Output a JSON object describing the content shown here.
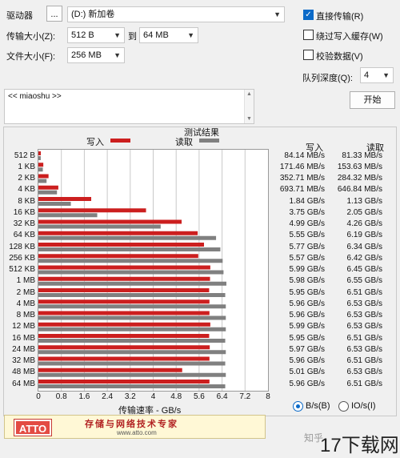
{
  "controls": {
    "drive_label": "驱动器",
    "drive_browse_label": "...",
    "drive_value": "(D:) 新加卷",
    "transfer_size_label": "传输大小(Z):",
    "transfer_from": "512 B",
    "to_label": "到",
    "transfer_to": "64 MB",
    "file_size_label": "文件大小(F):",
    "file_size": "256 MB",
    "direct_io_label": "直接传输(R)",
    "direct_io_checked": true,
    "bypass_cache_label": "绕过写入缓存(W)",
    "bypass_cache_checked": false,
    "verify_label": "校验数据(V)",
    "verify_checked": false,
    "queue_depth_label": "队列深度(Q):",
    "queue_depth": "4",
    "start_label": "开始",
    "description_text": "<< miaoshu >>"
  },
  "results": {
    "title": "测试结果",
    "write_legend": "写入",
    "read_legend": "读取",
    "write_header": "写入",
    "read_header": "读取",
    "x_axis_title": "传输速率 - GB/s",
    "unit_bs_label": "B/s(B)",
    "unit_bs_selected": true,
    "unit_io_label": "IO/s(I)",
    "unit_io_selected": false
  },
  "colors": {
    "write": "#cc1f1f",
    "read": "#808080"
  },
  "chart_data": {
    "type": "bar",
    "orientation": "horizontal",
    "title": "测试结果",
    "xlabel": "传输速率 - GB/s",
    "xlim": [
      0,
      8
    ],
    "x_ticks": [
      "0",
      "0.8",
      "1.6",
      "2.4",
      "3.2",
      "4",
      "4.8",
      "5.6",
      "6.4",
      "7.2",
      "8"
    ],
    "categories": [
      "512 B",
      "1 KB",
      "2 KB",
      "4 KB",
      "8 KB",
      "16 KB",
      "32 KB",
      "64 KB",
      "128 KB",
      "256 KB",
      "512 KB",
      "1 MB",
      "2 MB",
      "4 MB",
      "8 MB",
      "12 MB",
      "16 MB",
      "24 MB",
      "32 MB",
      "48 MB",
      "64 MB"
    ],
    "series": [
      {
        "name": "写入",
        "values": [
          0.084,
          0.171,
          0.353,
          0.694,
          1.84,
          3.75,
          4.99,
          5.55,
          5.77,
          5.57,
          5.99,
          5.98,
          5.95,
          5.96,
          5.96,
          5.99,
          5.95,
          5.97,
          5.96,
          5.01,
          5.96
        ],
        "labels": [
          "84.14 MB/s",
          "171.46 MB/s",
          "352.71 MB/s",
          "693.71 MB/s",
          "1.84 GB/s",
          "3.75 GB/s",
          "4.99 GB/s",
          "5.55 GB/s",
          "5.77 GB/s",
          "5.57 GB/s",
          "5.99 GB/s",
          "5.98 GB/s",
          "5.95 GB/s",
          "5.96 GB/s",
          "5.96 GB/s",
          "5.99 GB/s",
          "5.95 GB/s",
          "5.97 GB/s",
          "5.96 GB/s",
          "5.01 GB/s",
          "5.96 GB/s"
        ]
      },
      {
        "name": "读取",
        "values": [
          0.081,
          0.154,
          0.284,
          0.647,
          1.13,
          2.05,
          4.26,
          6.19,
          6.34,
          6.42,
          6.45,
          6.55,
          6.51,
          6.53,
          6.53,
          6.53,
          6.51,
          6.53,
          6.51,
          6.53,
          6.51
        ],
        "labels": [
          "81.33 MB/s",
          "153.63 MB/s",
          "284.32 MB/s",
          "646.84 MB/s",
          "1.13 GB/s",
          "2.05 GB/s",
          "4.26 GB/s",
          "6.19 GB/s",
          "6.34 GB/s",
          "6.42 GB/s",
          "6.45 GB/s",
          "6.55 GB/s",
          "6.51 GB/s",
          "6.53 GB/s",
          "6.53 GB/s",
          "6.53 GB/s",
          "6.51 GB/s",
          "6.53 GB/s",
          "6.51 GB/s",
          "6.53 GB/s",
          "6.51 GB/s"
        ]
      }
    ]
  },
  "banner": {
    "logo_text": "ATTO",
    "slogan": "存储与网络技术专家",
    "url": "www.atto.com"
  },
  "watermark": {
    "text1": "知乎",
    "text2": "17下载网"
  }
}
